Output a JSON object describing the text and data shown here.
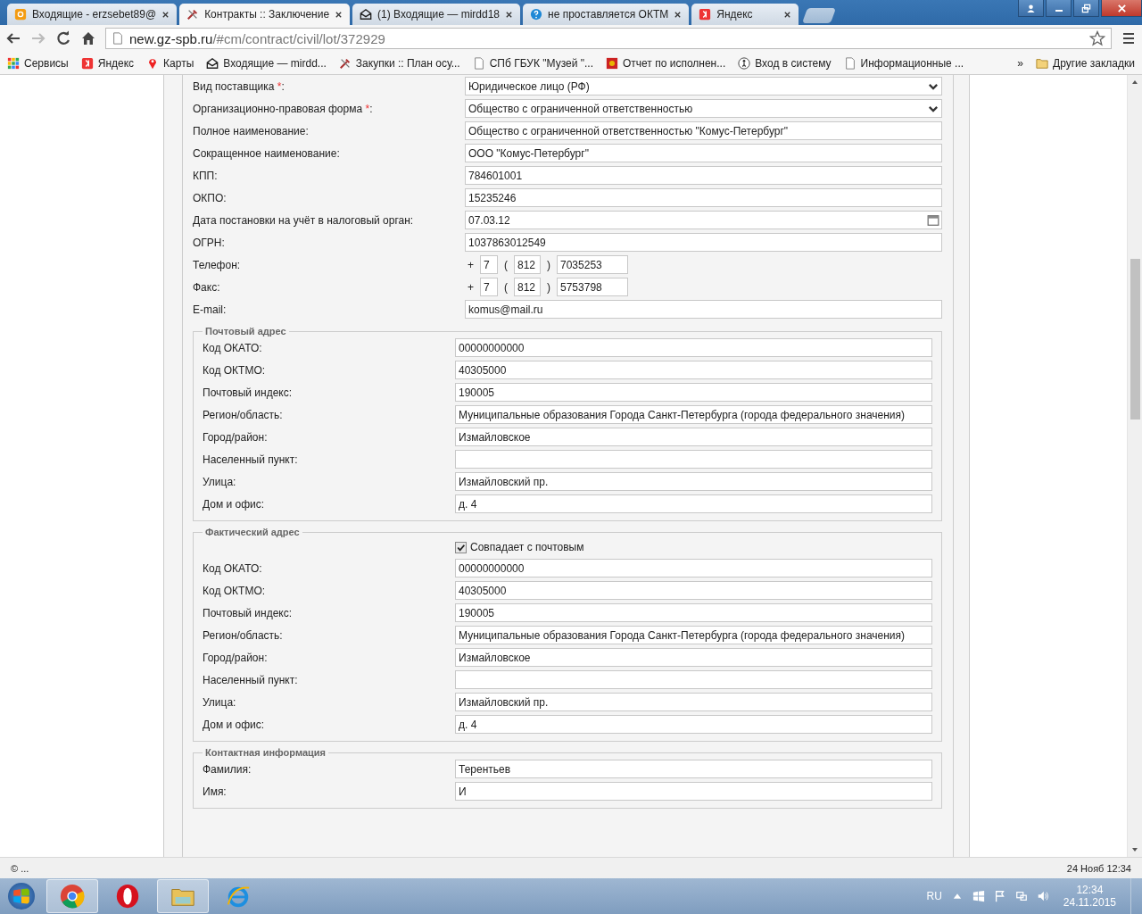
{
  "tabs": [
    {
      "title": "Входящие - erzsebet89@",
      "kind": "mail",
      "selected": false
    },
    {
      "title": "Контракты :: Заключение",
      "kind": "tools",
      "selected": true
    },
    {
      "title": "(1) Входящие — mirdd18",
      "kind": "envelope",
      "selected": false
    },
    {
      "title": "не проставляется ОКТМ",
      "kind": "help",
      "selected": false
    },
    {
      "title": "Яндекс",
      "kind": "yandex",
      "selected": false
    }
  ],
  "address": {
    "host": "new.gz-spb.ru",
    "path": "/#cm/contract/civil/lot/372929"
  },
  "bookmarks": [
    {
      "label": "Сервисы",
      "kind": "apps"
    },
    {
      "label": "Яндекс",
      "kind": "yandex"
    },
    {
      "label": "Карты",
      "kind": "pin"
    },
    {
      "label": "Входящие — mirdd...",
      "kind": "envelope"
    },
    {
      "label": "Закупки :: План осу...",
      "kind": "tools"
    },
    {
      "label": "СПб ГБУК \"Музей \"...",
      "kind": "page"
    },
    {
      "label": "Отчет по исполнен...",
      "kind": "emblem"
    },
    {
      "label": "Вход в систему",
      "kind": "person"
    },
    {
      "label": "Информационные ...",
      "kind": "page"
    }
  ],
  "bookmarks_overflow": "»",
  "other_bookmarks": "Другие закладки",
  "fields": [
    {
      "label": "Вид поставщика",
      "required": true,
      "kind": "select",
      "value": "Юридическое лицо (РФ)"
    },
    {
      "label": "Организационно-правовая форма",
      "required": true,
      "kind": "select",
      "value": "Общество с ограниченной ответственностью"
    },
    {
      "label": "Полное наименование:",
      "required": false,
      "kind": "text",
      "value": "Общество с ограниченной ответственностью \"Комус-Петербург\""
    },
    {
      "label": "Сокращенное наименование:",
      "required": false,
      "kind": "text",
      "value": "ООО \"Комус-Петербург\""
    },
    {
      "label": "КПП:",
      "required": false,
      "kind": "text",
      "value": "784601001"
    },
    {
      "label": "ОКПО:",
      "required": false,
      "kind": "text",
      "value": "15235246"
    },
    {
      "label": "Дата постановки на учёт в налоговый орган:",
      "required": false,
      "kind": "date",
      "value": "07.03.12"
    },
    {
      "label": "ОГРН:",
      "required": false,
      "kind": "text",
      "value": "1037863012549"
    },
    {
      "label": "Телефон:",
      "required": false,
      "kind": "phone",
      "plus": "+",
      "open": "(",
      "close": ")",
      "country": "7",
      "area": "812",
      "number": "7035253"
    },
    {
      "label": "Факс:",
      "required": false,
      "kind": "phone",
      "plus": "+",
      "open": "(",
      "close": ")",
      "country": "7",
      "area": "812",
      "number": "5753798"
    },
    {
      "label": "E-mail:",
      "required": false,
      "kind": "text",
      "value": "komus@mail.ru"
    }
  ],
  "required_mark": "*",
  "required_suffix": ":",
  "sections": [
    {
      "legend": "Почтовый адрес",
      "fields": [
        {
          "label": "Код ОКАТО:",
          "value": "00000000000"
        },
        {
          "label": "Код ОКТМО:",
          "value": "40305000"
        },
        {
          "label": "Почтовый индекс:",
          "value": "190005"
        },
        {
          "label": "Регион/область:",
          "value": "Муниципальные образования Города Санкт-Петербурга (города федерального значения)"
        },
        {
          "label": "Город/район:",
          "value": "Измайловское"
        },
        {
          "label": "Населенный пункт:"
        },
        {
          "label": "Улица:",
          "value": "Измайловский пр."
        },
        {
          "label": "Дом и офис:",
          "value": "д. 4"
        }
      ]
    },
    {
      "legend": "Фактический адрес",
      "same": {
        "label": "Совпадает с почтовым",
        "checked": true
      },
      "fields": [
        {
          "label": "Код ОКАТО:",
          "value": "00000000000"
        },
        {
          "label": "Код ОКТМО:",
          "value": "40305000"
        },
        {
          "label": "Почтовый индекс:",
          "value": "190005"
        },
        {
          "label": "Регион/область:",
          "value": "Муниципальные образования Города Санкт-Петербурга (города федерального значения)"
        },
        {
          "label": "Город/район:",
          "value": "Измайловское"
        },
        {
          "label": "Населенный пункт:"
        },
        {
          "label": "Улица:",
          "value": "Измайловский пр."
        },
        {
          "label": "Дом и офис:",
          "value": "д. 4"
        }
      ]
    },
    {
      "legend": "Контактная информация",
      "fields": [
        {
          "label": "Фамилия:",
          "value": "Терентьев"
        },
        {
          "label": "Имя:",
          "value": "И"
        }
      ]
    }
  ],
  "status": {
    "left": "© ...",
    "right": "24 Нояб 12:34"
  },
  "taskbar": {
    "language": "RU",
    "time": "12:34",
    "date": "24.11.2015",
    "apps": [
      {
        "kind": "chrome",
        "selected": true
      },
      {
        "kind": "opera",
        "selected": false
      },
      {
        "kind": "folder",
        "selected": true
      },
      {
        "kind": "ie",
        "selected": false
      }
    ]
  }
}
